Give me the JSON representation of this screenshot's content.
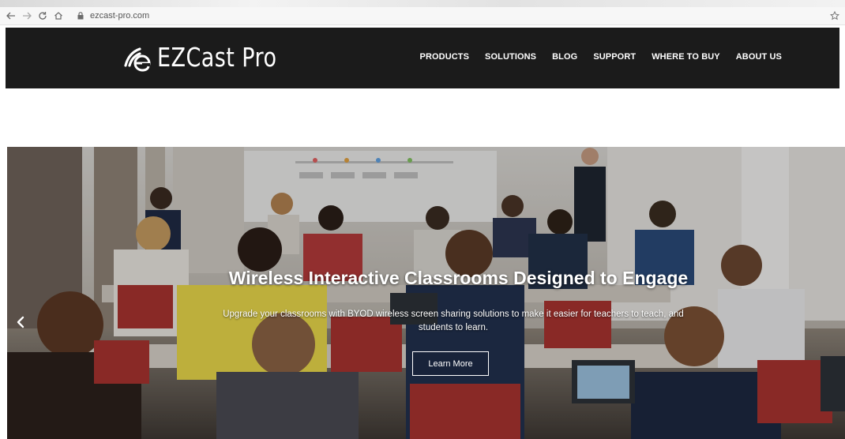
{
  "browser": {
    "url": "ezcast-pro.com",
    "icons": [
      "back-arrow-icon",
      "forward-arrow-icon",
      "reload-icon",
      "home-icon",
      "lock-icon",
      "bookmark-star-icon"
    ]
  },
  "header": {
    "logo_text": "EZCast Pro",
    "nav": [
      {
        "label": "PRODUCTS"
      },
      {
        "label": "SOLUTIONS"
      },
      {
        "label": "BLOG"
      },
      {
        "label": "SUPPORT"
      },
      {
        "label": "WHERE TO BUY"
      },
      {
        "label": "ABOUT US"
      }
    ]
  },
  "hero": {
    "title": "Wireless Interactive Classrooms Designed to Engage",
    "subtitle_line1": "Upgrade your classrooms with BYOD wireless screen sharing solutions to make it easier for teachers to teach, and",
    "subtitle_line2": "students to learn.",
    "button_label": "Learn More"
  },
  "colors": {
    "header_bg": "#1b1b1b",
    "nav_text": "#ffffff",
    "page_bg": "#ffffff"
  }
}
